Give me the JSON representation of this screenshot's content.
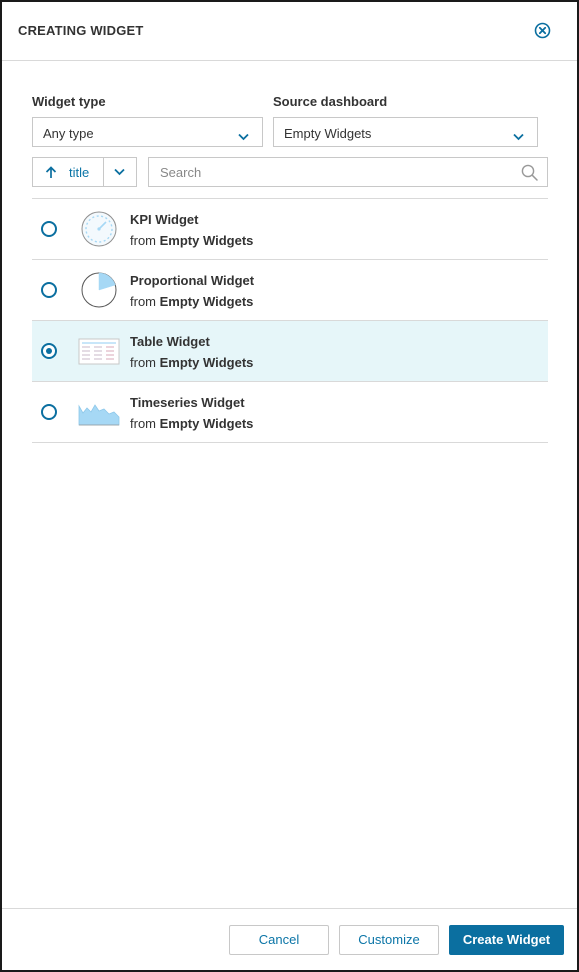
{
  "dialog": {
    "title": "CREATING WIDGET",
    "close_icon": "close-circle-icon"
  },
  "filters": {
    "widget_type_label": "Widget type",
    "widget_type_value": "Any type",
    "source_dashboard_label": "Source dashboard",
    "source_dashboard_value": "Empty Widgets"
  },
  "sort": {
    "direction_icon": "arrow-up-icon",
    "label": "title"
  },
  "search": {
    "placeholder": "Search",
    "value": ""
  },
  "widgets": [
    {
      "name": "KPI Widget",
      "from_prefix": "from",
      "source": "Empty Widgets",
      "icon": "kpi-gauge-icon",
      "selected": false
    },
    {
      "name": "Proportional Widget",
      "from_prefix": "from",
      "source": "Empty Widgets",
      "icon": "pie-chart-icon",
      "selected": false
    },
    {
      "name": "Table Widget",
      "from_prefix": "from",
      "source": "Empty Widgets",
      "icon": "table-icon",
      "selected": true
    },
    {
      "name": "Timeseries Widget",
      "from_prefix": "from",
      "source": "Empty Widgets",
      "icon": "area-chart-icon",
      "selected": false
    }
  ],
  "footer": {
    "cancel_label": "Cancel",
    "customize_label": "Customize",
    "create_label": "Create Widget"
  },
  "colors": {
    "accent": "#0b6fa0",
    "link": "#0b75a7",
    "selected_row": "#e6f6f9",
    "thumb_fill": "#a6d8f5"
  }
}
